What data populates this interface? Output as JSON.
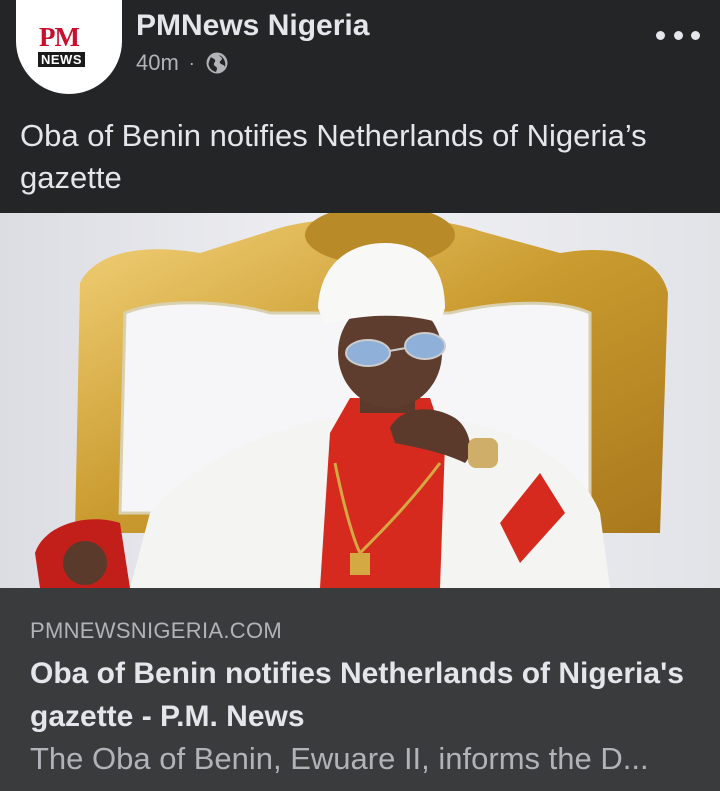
{
  "post": {
    "page_name": "PMNews Nigeria",
    "time_ago": "40m",
    "separator": "·",
    "audience_icon": "globe-icon",
    "more_icon": "more-options-icon",
    "caption": "Oba of Benin notifies Netherlands of Nigeria’s gazette"
  },
  "avatar": {
    "logo_top": "PM",
    "logo_bottom": "NEWS"
  },
  "link_preview": {
    "domain": "PMNEWSNIGERIA.COM",
    "title": "Oba of Benin notifies Netherlands of Nigeria's gazette - P.M. News",
    "description": "The Oba of Benin, Ewuare II, informs the D..."
  },
  "colors": {
    "background": "#242526",
    "link_box": "#3a3b3c",
    "primary_text": "#e4e6eb",
    "secondary_text": "#b0b3b8",
    "logo_red": "#c8102e"
  }
}
